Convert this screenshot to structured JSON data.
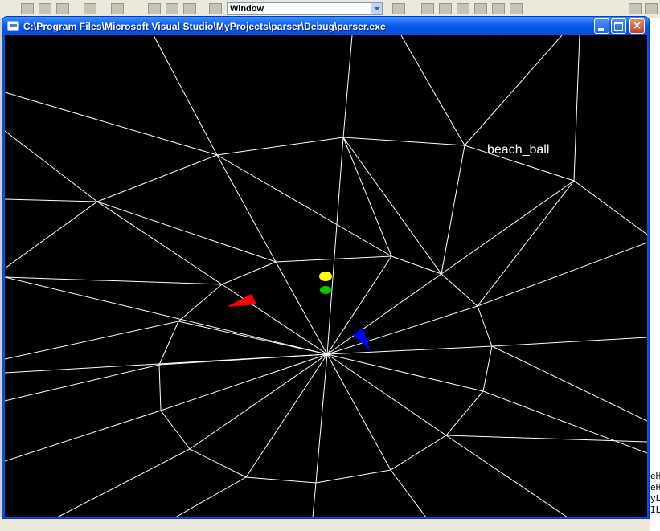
{
  "window": {
    "title": "C:\\Program Files\\Microsoft Visual Studio\\MyProjects\\parser\\Debug\\parser.exe",
    "close_glyph": "×"
  },
  "ide": {
    "window_combo_value": "Window",
    "right_panel_text": "eH\neH\nyL\nILLER"
  },
  "scene": {
    "object_label": "beach_ball",
    "colors": {
      "background": "#000000",
      "wireframe": "#ffffff",
      "ball_top": "#ffff00",
      "ball_bottom": "#00cc00",
      "marker_left": "#ff0000",
      "marker_right": "#0000ff"
    }
  }
}
